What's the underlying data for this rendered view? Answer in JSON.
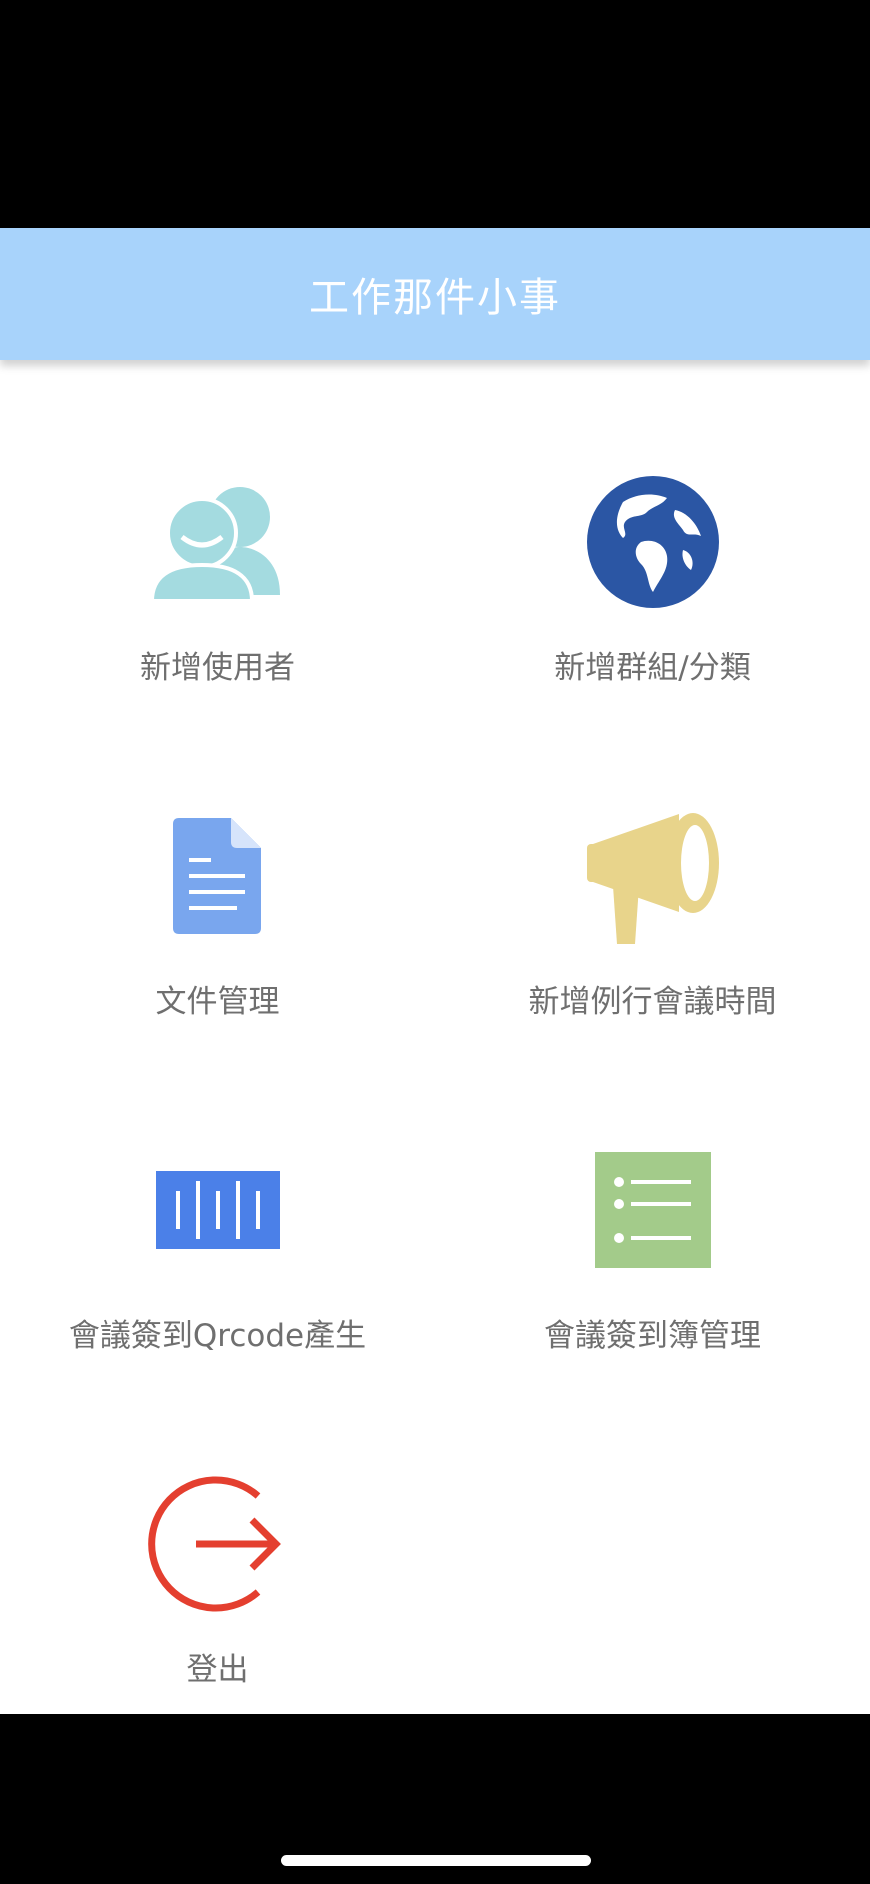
{
  "app": {
    "title": "工作那件小事"
  },
  "menu": {
    "items": [
      {
        "label": "新增使用者",
        "icon": "users-icon",
        "color": "#a4dbe0"
      },
      {
        "label": "新增群組/分類",
        "icon": "globe-icon",
        "color": "#2b56a4"
      },
      {
        "label": "文件管理",
        "icon": "document-icon",
        "color": "#79a6ee"
      },
      {
        "label": "新增例行會議時間",
        "icon": "megaphone-icon",
        "color": "#e8d48b"
      },
      {
        "label": "會議簽到Qrcode產生",
        "icon": "barcode-icon",
        "color": "#4b80e8"
      },
      {
        "label": "會議簽到簿管理",
        "icon": "list-icon",
        "color": "#a3cb8a"
      },
      {
        "label": "登出",
        "icon": "logout-icon",
        "color": "#e43f2f"
      }
    ]
  },
  "colors": {
    "appbar": "#a8d3fb",
    "label": "#6f6f6f"
  }
}
